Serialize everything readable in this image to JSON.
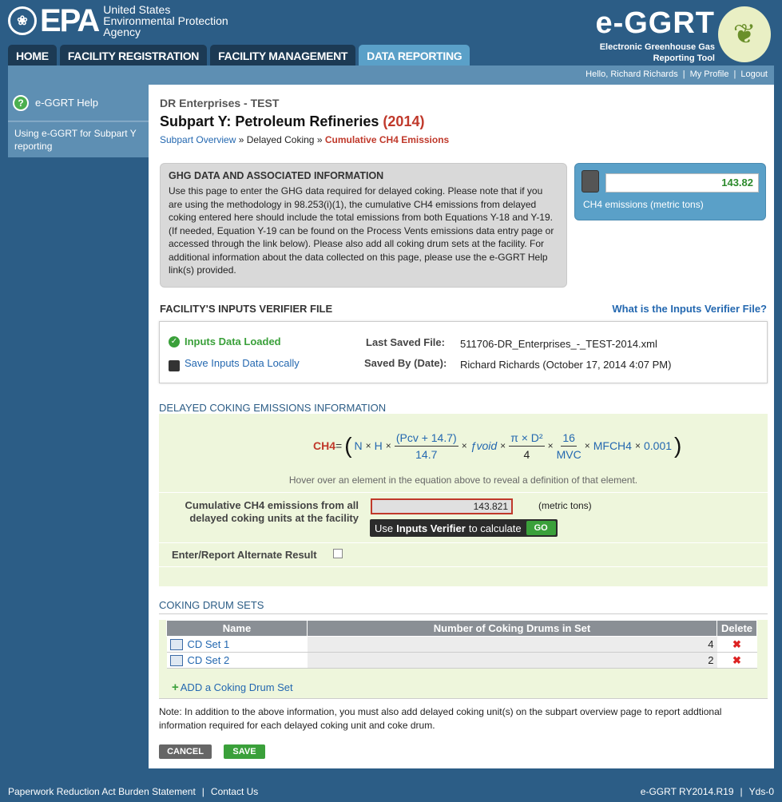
{
  "header": {
    "epa_mark": "EPA",
    "epa_agency_lines": [
      "United States",
      "Environmental Protection",
      "Agency"
    ],
    "app_title": "e-GGRT",
    "app_subtitle_lines": [
      "Electronic Greenhouse Gas",
      "Reporting Tool"
    ],
    "nav": [
      {
        "label": "HOME",
        "active": false
      },
      {
        "label": "FACILITY REGISTRATION",
        "active": false
      },
      {
        "label": "FACILITY MANAGEMENT",
        "active": false
      },
      {
        "label": "DATA REPORTING",
        "active": true
      }
    ],
    "greeting": "Hello, Richard Richards",
    "my_profile": "My Profile",
    "logout": "Logout"
  },
  "sidebar": {
    "help_title": "e-GGRT Help",
    "help_link": "Using e-GGRT for Subpart Y reporting"
  },
  "main": {
    "org": "DR Enterprises - TEST",
    "subpart_title": "Subpart Y: Petroleum Refineries",
    "year": "(2014)",
    "breadcrumb": {
      "link": "Subpart Overview",
      "sep": "»",
      "mid": "Delayed Coking",
      "current": "Cumulative CH4 Emissions"
    },
    "ghg_box": {
      "title": "GHG DATA AND ASSOCIATED INFORMATION",
      "body": "Use this page to enter the GHG data required for delayed coking. Please note that if you are using the methodology in 98.253(i)(1), the cumulative CH4 emissions from delayed coking entered here should include the total emissions from both Equations Y-18 and Y-19. (If needed, Equation Y-19 can be found on the Process Vents emissions data entry page or accessed through the link below). Please also add all coking drum sets at the facility. For additional information about the data collected on this page, please use the e-GGRT Help link(s) provided."
    },
    "calc": {
      "value": "143.82",
      "label": "CH4 emissions (metric tons)"
    },
    "verifier": {
      "title": "FACILITY'S INPUTS VERIFIER FILE",
      "help_link": "What is the Inputs Verifier File?",
      "status": "Inputs Data Loaded",
      "save_local": "Save Inputs Data Locally",
      "last_saved_label": "Last Saved File:",
      "last_saved_value": "511706-DR_Enterprises_-_TEST-2014.xml",
      "saved_by_label": "Saved By (Date):",
      "saved_by_value": "Richard Richards (October 17, 2014 4:07 PM)"
    },
    "coking": {
      "section_title": "DELAYED COKING EMISSIONS INFORMATION",
      "eq": {
        "lhs": "CH4",
        "eq": "=",
        "n": "N",
        "h": "H",
        "pcv_num": "(Pcv + 14.7)",
        "pcv_den": "14.7",
        "fvoid": "ƒvoid",
        "pi_num": "π × D²",
        "pi_den": "4",
        "mvc_num": "16",
        "mvc_den": "MVC",
        "mf": "MFCH4",
        "const": "0.001",
        "times": "×"
      },
      "hover_note": "Hover over an element in the equation above to reveal a definition of that element.",
      "cum_label": "Cumulative CH4 emissions from all delayed coking units at the facility",
      "cum_value": "143.821",
      "cum_unit": "(metric tons)",
      "tip_prefix": "Use",
      "tip_bold": "Inputs Verifier",
      "tip_suffix": "to calculate",
      "go": "GO",
      "alt_label": "Enter/Report Alternate Result"
    },
    "drums": {
      "section_title": "COKING DRUM SETS",
      "headers": [
        "Name",
        "Number of Coking Drums in Set",
        "Delete"
      ],
      "rows": [
        {
          "name": "CD Set 1",
          "count": "4"
        },
        {
          "name": "CD Set 2",
          "count": "2"
        }
      ],
      "add": "ADD a Coking Drum Set"
    },
    "note": "Note: In addition to the above information, you must also add delayed coking unit(s) on the subpart overview page to report addtional information required for each delayed coking unit and coke drum.",
    "cancel": "CANCEL",
    "save": "SAVE"
  },
  "footer": {
    "paperwork": "Paperwork Reduction Act Burden Statement",
    "contact": "Contact Us",
    "version": "e-GGRT RY2014.R19",
    "build": "Yds-0"
  }
}
